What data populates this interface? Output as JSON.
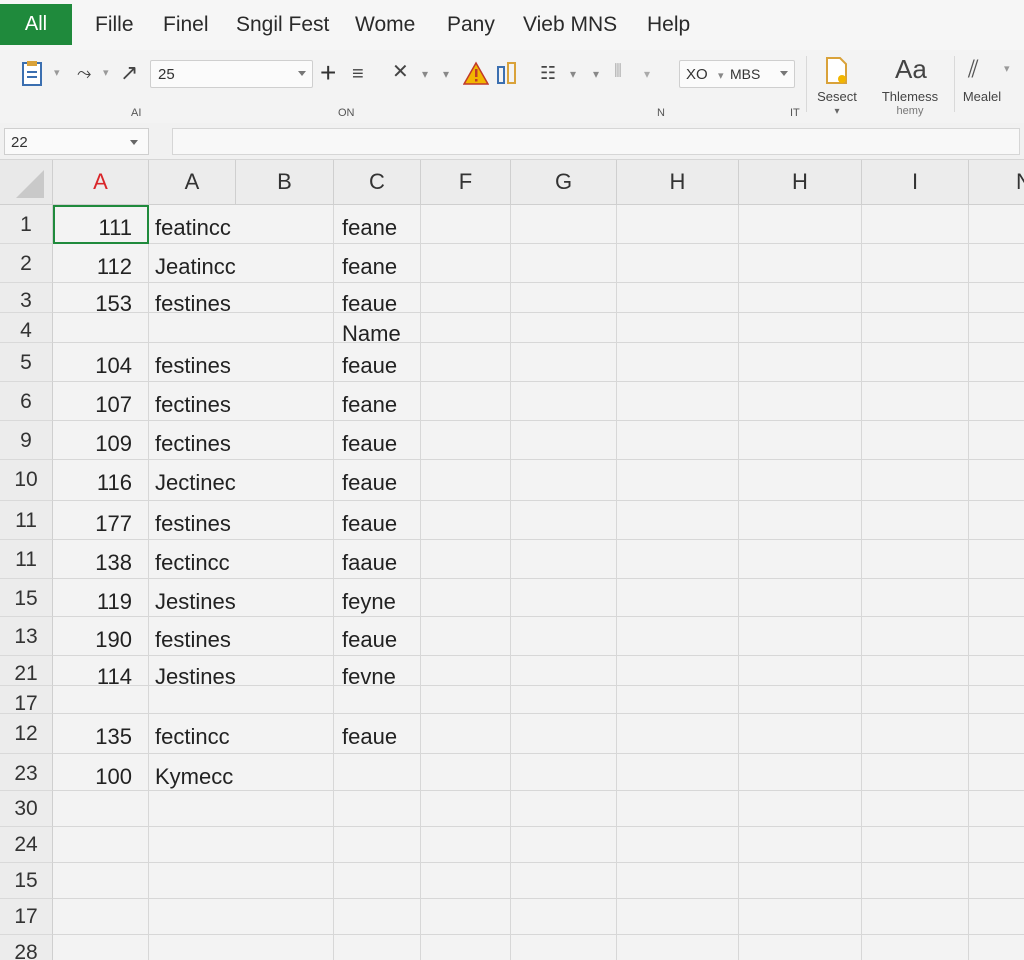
{
  "menubar": {
    "app_tab": "All",
    "items": [
      "Fille",
      "Finel",
      "Sngil Fest",
      "Wome",
      "Pany",
      "Vieb MNS",
      "Help"
    ]
  },
  "ribbon": {
    "font_size": "25",
    "style_combo": "XO",
    "style_combo_2": "MBS",
    "select_label": "Sesect",
    "themes_label": "Thlemess",
    "themes_label_2": "hemy",
    "model_label": "Mealel",
    "group_labels": [
      "AI",
      "ON",
      "N",
      "IT"
    ]
  },
  "formula_bar": {
    "name_box": "22",
    "formula": ""
  },
  "grid": {
    "columns": [
      "A",
      "A",
      "B",
      "C",
      "F",
      "G",
      "H",
      "H",
      "I",
      "N"
    ],
    "selected_column": "A",
    "rows": [
      {
        "head": "1",
        "a": "111",
        "b": "featincc",
        "c": "feane"
      },
      {
        "head": "2",
        "a": "112",
        "b": "Jeatincc",
        "c": "feane"
      },
      {
        "head": "3",
        "a": "153",
        "b": "festines",
        "c": "feaue"
      },
      {
        "head": "4",
        "a": "",
        "b": "",
        "c": "Name"
      },
      {
        "head": "5",
        "a": "104",
        "b": "festines",
        "c": "feaue"
      },
      {
        "head": "6",
        "a": "107",
        "b": "fectines",
        "c": "feane"
      },
      {
        "head": "9",
        "a": "109",
        "b": "fectines",
        "c": "feaue"
      },
      {
        "head": "10",
        "a": "116",
        "b": "Jectinec",
        "c": "feaue"
      },
      {
        "head": "11",
        "a": "177",
        "b": "festines",
        "c": "feaue"
      },
      {
        "head": "11",
        "a": "138",
        "b": "fectincc",
        "c": "faaue"
      },
      {
        "head": "15",
        "a": "119",
        "b": "Jestines",
        "c": "feyne"
      },
      {
        "head": "13",
        "a": "190",
        "b": "festines",
        "c": "feaue"
      },
      {
        "head": "21",
        "a": "114",
        "b": "Jestines",
        "c": "fevne"
      },
      {
        "head": "17",
        "a": "",
        "b": "",
        "c": ""
      },
      {
        "head": "12",
        "a": "135",
        "b": "fectincc",
        "c": "feaue"
      },
      {
        "head": "23",
        "a": "100",
        "b": "Kymecc",
        "c": ""
      },
      {
        "head": "30",
        "a": "",
        "b": "",
        "c": ""
      },
      {
        "head": "24",
        "a": "",
        "b": "",
        "c": ""
      },
      {
        "head": "15",
        "a": "",
        "b": "",
        "c": ""
      },
      {
        "head": "17",
        "a": "",
        "b": "",
        "c": ""
      },
      {
        "head": "28",
        "a": "",
        "b": "",
        "c": ""
      }
    ]
  },
  "colors": {
    "accent_green": "#1f8a3c",
    "selected_column_red": "#d9262a",
    "warning_yellow": "#f2b600"
  }
}
